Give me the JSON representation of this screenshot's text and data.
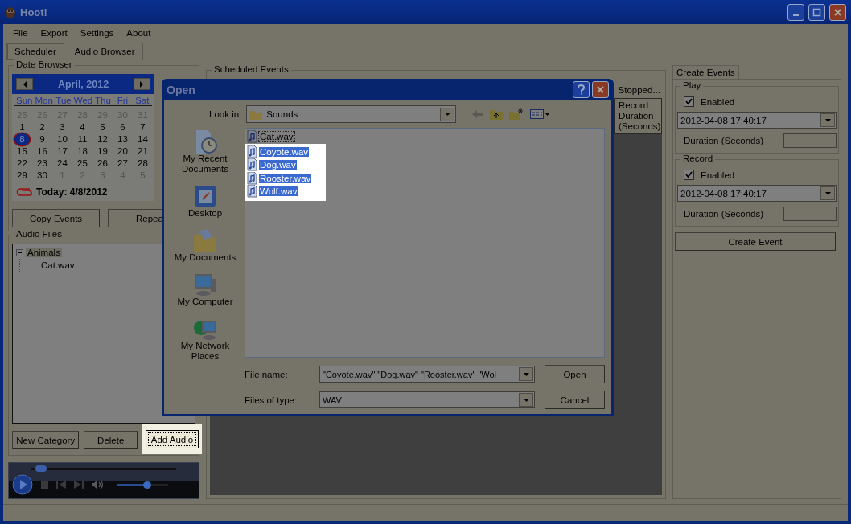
{
  "window": {
    "title": "Hoot!"
  },
  "menu": [
    "File",
    "Export",
    "Settings",
    "About"
  ],
  "tabs": [
    {
      "label": "Scheduler",
      "selected": true
    },
    {
      "label": "Audio Browser",
      "selected": false
    }
  ],
  "date_browser": {
    "title": "Date Browser",
    "month": "April, 2012",
    "weekdays": [
      "Sun",
      "Mon",
      "Tue",
      "Wed",
      "Thu",
      "Fri",
      "Sat"
    ],
    "weeks": [
      [
        {
          "day": "25",
          "other_month": true,
          "selected": false
        },
        {
          "day": "26",
          "other_month": true,
          "selected": false
        },
        {
          "day": "27",
          "other_month": true,
          "selected": false
        },
        {
          "day": "28",
          "other_month": true,
          "selected": false
        },
        {
          "day": "29",
          "other_month": true,
          "selected": false
        },
        {
          "day": "30",
          "other_month": true,
          "selected": false
        },
        {
          "day": "31",
          "other_month": true,
          "selected": false
        }
      ],
      [
        {
          "day": "1",
          "other_month": false,
          "selected": false
        },
        {
          "day": "2",
          "other_month": false,
          "selected": false
        },
        {
          "day": "3",
          "other_month": false,
          "selected": false
        },
        {
          "day": "4",
          "other_month": false,
          "selected": false
        },
        {
          "day": "5",
          "other_month": false,
          "selected": false
        },
        {
          "day": "6",
          "other_month": false,
          "selected": false
        },
        {
          "day": "7",
          "other_month": false,
          "selected": false
        }
      ],
      [
        {
          "day": "8",
          "other_month": false,
          "selected": true
        },
        {
          "day": "9",
          "other_month": false,
          "selected": false
        },
        {
          "day": "10",
          "other_month": false,
          "selected": false
        },
        {
          "day": "11",
          "other_month": false,
          "selected": false
        },
        {
          "day": "12",
          "other_month": false,
          "selected": false
        },
        {
          "day": "13",
          "other_month": false,
          "selected": false
        },
        {
          "day": "14",
          "other_month": false,
          "selected": false
        }
      ],
      [
        {
          "day": "15",
          "other_month": false,
          "selected": false
        },
        {
          "day": "16",
          "other_month": false,
          "selected": false
        },
        {
          "day": "17",
          "other_month": false,
          "selected": false
        },
        {
          "day": "18",
          "other_month": false,
          "selected": false
        },
        {
          "day": "19",
          "other_month": false,
          "selected": false
        },
        {
          "day": "20",
          "other_month": false,
          "selected": false
        },
        {
          "day": "21",
          "other_month": false,
          "selected": false
        }
      ],
      [
        {
          "day": "22",
          "other_month": false,
          "selected": false
        },
        {
          "day": "23",
          "other_month": false,
          "selected": false
        },
        {
          "day": "24",
          "other_month": false,
          "selected": false
        },
        {
          "day": "25",
          "other_month": false,
          "selected": false
        },
        {
          "day": "26",
          "other_month": false,
          "selected": false
        },
        {
          "day": "27",
          "other_month": false,
          "selected": false
        },
        {
          "day": "28",
          "other_month": false,
          "selected": false
        }
      ],
      [
        {
          "day": "29",
          "other_month": false,
          "selected": false
        },
        {
          "day": "30",
          "other_month": false,
          "selected": false
        },
        {
          "day": "1",
          "other_month": true,
          "selected": false
        },
        {
          "day": "2",
          "other_month": true,
          "selected": false
        },
        {
          "day": "3",
          "other_month": true,
          "selected": false
        },
        {
          "day": "4",
          "other_month": true,
          "selected": false
        },
        {
          "day": "5",
          "other_month": true,
          "selected": false
        }
      ]
    ],
    "today": "Today: 4/8/2012",
    "buttons": [
      "Copy Events",
      "Repea"
    ]
  },
  "audio_files": {
    "title": "Audio Files",
    "tree": [
      {
        "label": "Animals",
        "expanded": true,
        "selected": true,
        "children": [
          {
            "label": "Cat.wav",
            "selected": false
          }
        ]
      }
    ],
    "buttons": [
      {
        "label": "New Category",
        "focused": false
      },
      {
        "label": "Delete",
        "focused": false
      },
      {
        "label": "Add Audio",
        "focused": true
      }
    ]
  },
  "media_player": {
    "seek": {
      "level": 0.03
    },
    "volume": {
      "level": 0.6
    }
  },
  "scheduled_events": {
    "title": "Scheduled Events",
    "status": "Stopped...",
    "columns": [
      "Record Duration (Seconds)"
    ]
  },
  "create_events": {
    "tab": "Create Events",
    "groups": [
      {
        "title": "Play",
        "enabled": true,
        "enabled_label": "Enabled",
        "datetime": "2012-04-08 17:40:17",
        "duration_label": "Duration (Seconds)"
      },
      {
        "title": "Record",
        "enabled": true,
        "enabled_label": "Enabled",
        "datetime": "2012-04-08 17:40:17",
        "duration_label": "Duration (Seconds)"
      }
    ],
    "button": "Create Event"
  },
  "dialog": {
    "title": "Open",
    "look_in_label": "Look in:",
    "look_in": "Sounds",
    "places": [
      {
        "kind": "recent",
        "label": "My Recent Documents"
      },
      {
        "kind": "desktop",
        "label": "Desktop"
      },
      {
        "kind": "documents",
        "label": "My Documents"
      },
      {
        "kind": "computer",
        "label": "My Computer"
      },
      {
        "kind": "network",
        "label": "My Network Places"
      }
    ],
    "files": [
      {
        "name": "Cat.wav",
        "selected": false
      },
      {
        "name": "Coyote.wav",
        "selected": true
      },
      {
        "name": "Dog.wav",
        "selected": true
      },
      {
        "name": "Rooster.wav",
        "selected": true
      },
      {
        "name": "Wolf.wav",
        "selected": true
      }
    ],
    "file_name_label": "File name:",
    "file_name": "\"Coyote.wav\" \"Dog.wav\" \"Rooster.wav\" \"Wol",
    "file_type_label": "Files of type:",
    "file_type": "WAV",
    "buttons": [
      "Open",
      "Cancel"
    ]
  }
}
